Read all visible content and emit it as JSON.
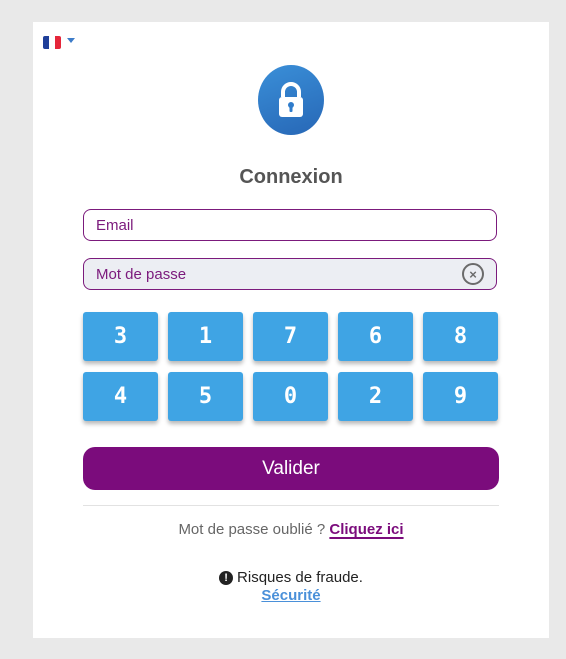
{
  "language": {
    "flag": "fr-flag-icon",
    "colors": [
      "#1f3f99",
      "#ffffff",
      "#e5263a"
    ]
  },
  "title": "Connexion",
  "email": {
    "placeholder": "Email",
    "value": ""
  },
  "password": {
    "placeholder": "Mot de passe",
    "value": ""
  },
  "keypad": {
    "keys": [
      "3",
      "1",
      "7",
      "6",
      "8",
      "4",
      "5",
      "0",
      "2",
      "9"
    ],
    "color": "#3fa4e4"
  },
  "submit_label": "Valider",
  "forgot": {
    "text": "Mot de passe oublié ?",
    "link": "Cliquez ici"
  },
  "fraud": {
    "text": "Risques de fraude.",
    "link": "Sécurité"
  },
  "colors": {
    "accent": "#7b0c7c",
    "lock": "#2f7ccb",
    "link": "#4a90d9"
  }
}
